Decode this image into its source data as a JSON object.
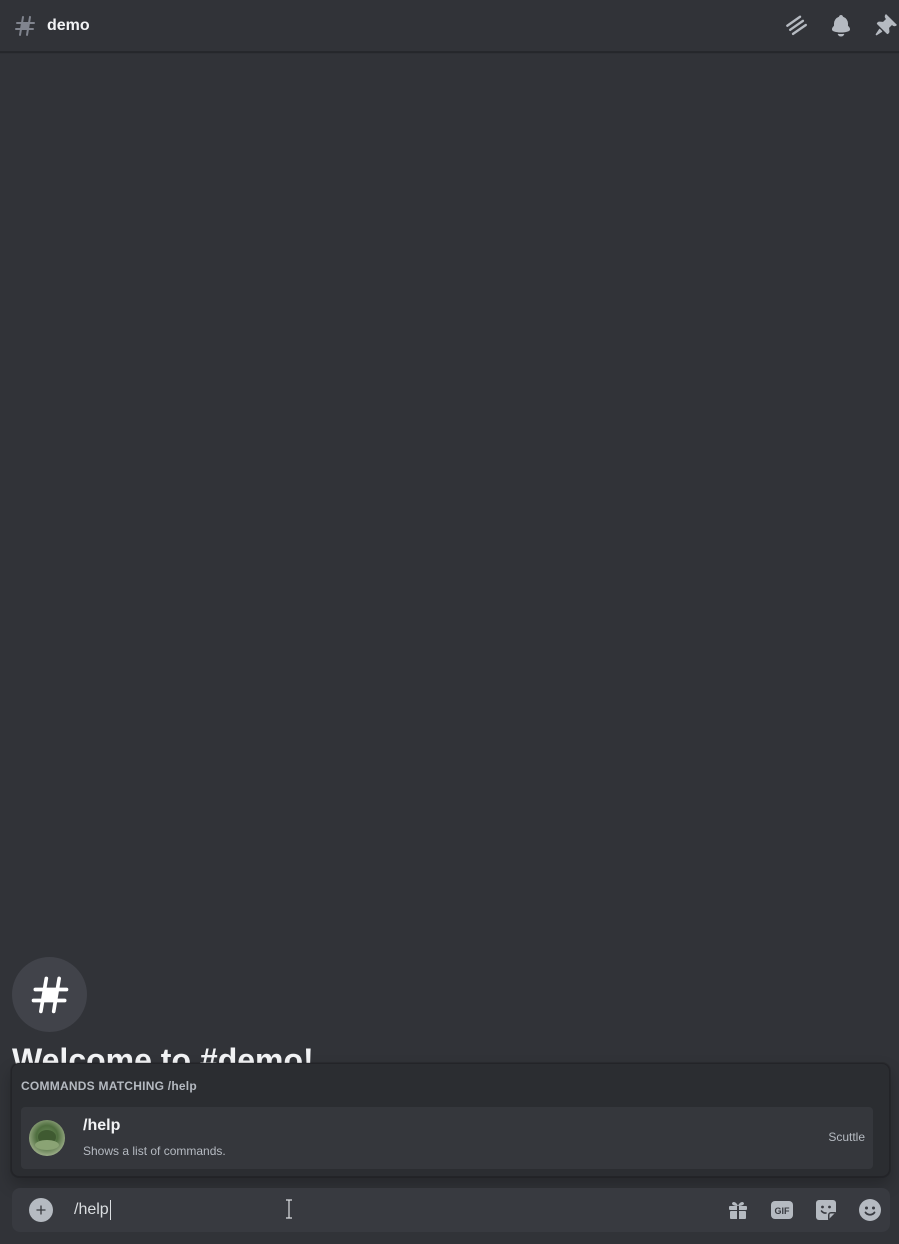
{
  "header": {
    "channel_name": "demo",
    "icons": [
      "hash-icon",
      "threads-icon",
      "bell-icon",
      "pin-icon"
    ]
  },
  "welcome": {
    "title": "Welcome to #demo!"
  },
  "autocomplete": {
    "header": "COMMANDS MATCHING /help",
    "items": [
      {
        "name": "/help",
        "description": "Shows a list of commands.",
        "source": "Scuttle"
      }
    ]
  },
  "composer": {
    "value": "/help",
    "icons": [
      "plus-circle-icon",
      "gift-icon",
      "gif-icon",
      "sticker-icon",
      "emoji-icon"
    ],
    "gif_label": "GIF"
  },
  "colors": {
    "background": "#313338",
    "popup": "#2b2d31",
    "selected_item": "#35373c",
    "composer": "#383a40",
    "icon": "#b5bac1"
  }
}
